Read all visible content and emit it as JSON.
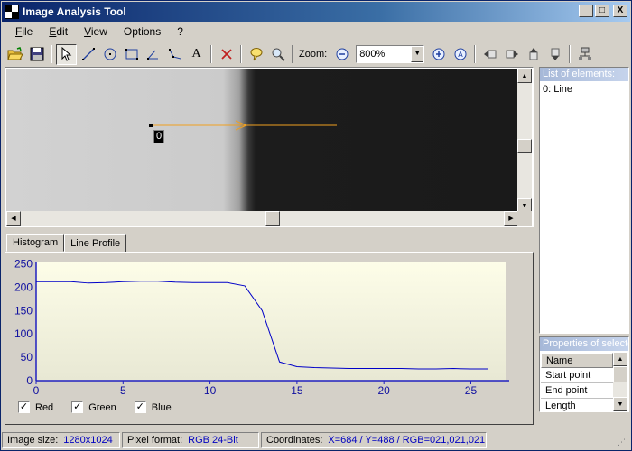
{
  "window": {
    "title": "Image Analysis Tool",
    "min_label": "_",
    "max_label": "□",
    "close_label": "X"
  },
  "menu": [
    {
      "label": "File",
      "accel": "F",
      "rest": "ile"
    },
    {
      "label": "Edit",
      "accel": "E",
      "rest": "dit"
    },
    {
      "label": "View",
      "accel": "V",
      "rest": "iew"
    },
    {
      "label": "Options",
      "accel": "",
      "rest": "Options"
    },
    {
      "label": "?",
      "accel": "",
      "rest": "?"
    }
  ],
  "toolbar": {
    "zoom_label": "Zoom:",
    "zoom_value": "800%",
    "text_tool_glyph": "A"
  },
  "image_view": {
    "line_label": "0",
    "line_color": "#f0a020"
  },
  "elements_panel": {
    "title": "List of elements:",
    "items": [
      "0: Line"
    ]
  },
  "properties_panel": {
    "title": "Properties of selected",
    "header": "Name",
    "rows": [
      "Start point",
      "End point",
      "Length"
    ]
  },
  "tabs": [
    {
      "label": "Histogram",
      "active": false
    },
    {
      "label": "Line Profile",
      "active": true
    }
  ],
  "channels": [
    {
      "label": "Red",
      "checked": true
    },
    {
      "label": "Green",
      "checked": true
    },
    {
      "label": "Blue",
      "checked": true
    }
  ],
  "checkmark": "✓",
  "chart_data": {
    "type": "line",
    "x": [
      0,
      1,
      2,
      3,
      4,
      5,
      6,
      7,
      8,
      9,
      10,
      11,
      12,
      13,
      14,
      15,
      16,
      17,
      18,
      19,
      20,
      21,
      22,
      23,
      24,
      25,
      26
    ],
    "series": [
      {
        "values": [
          212,
          212,
          212,
          209,
          210,
          212,
          213,
          213,
          211,
          210,
          210,
          210,
          203,
          150,
          40,
          30,
          28,
          27,
          26,
          26,
          26,
          26,
          25,
          25,
          26,
          25,
          25
        ]
      }
    ],
    "xlim": [
      0,
      27
    ],
    "ylim": [
      0,
      255
    ],
    "xticks": [
      0,
      5,
      10,
      15,
      20,
      25
    ],
    "yticks": [
      0,
      50,
      100,
      150,
      200,
      250
    ],
    "line_color": "#0000c8",
    "grid": false
  },
  "status": {
    "size_label": "Image size:",
    "size_value": "1280x1024",
    "format_label": "Pixel format:",
    "format_value": "RGB 24-Bit",
    "coords_label": "Coordinates:",
    "coords_value": "X=684 / Y=488 / RGB=021,021,021"
  }
}
